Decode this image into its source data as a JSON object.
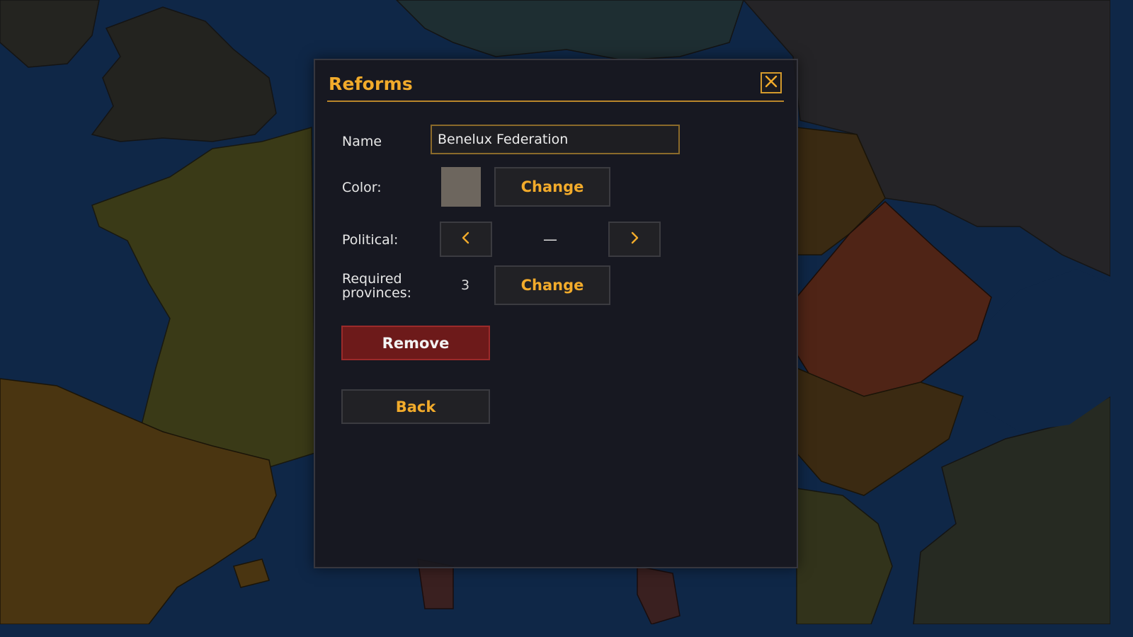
{
  "dialog": {
    "title": "Reforms",
    "name_label": "Name",
    "name_value": "Benelux Federation",
    "color_label": "Color:",
    "color_value": "#6d665e",
    "color_change_label": "Change",
    "political_label": "Political:",
    "political_value": "—",
    "required_label_line1": "Required",
    "required_label_line2": "provinces:",
    "required_value": "3",
    "required_change_label": "Change",
    "remove_label": "Remove",
    "back_label": "Back"
  },
  "icons": {
    "close": "close-icon",
    "prev": "chevron-left-icon",
    "next": "chevron-right-icon"
  },
  "colors": {
    "accent": "#f2ab2b",
    "danger": "#6d1a1a",
    "sea": "#0f2747"
  }
}
